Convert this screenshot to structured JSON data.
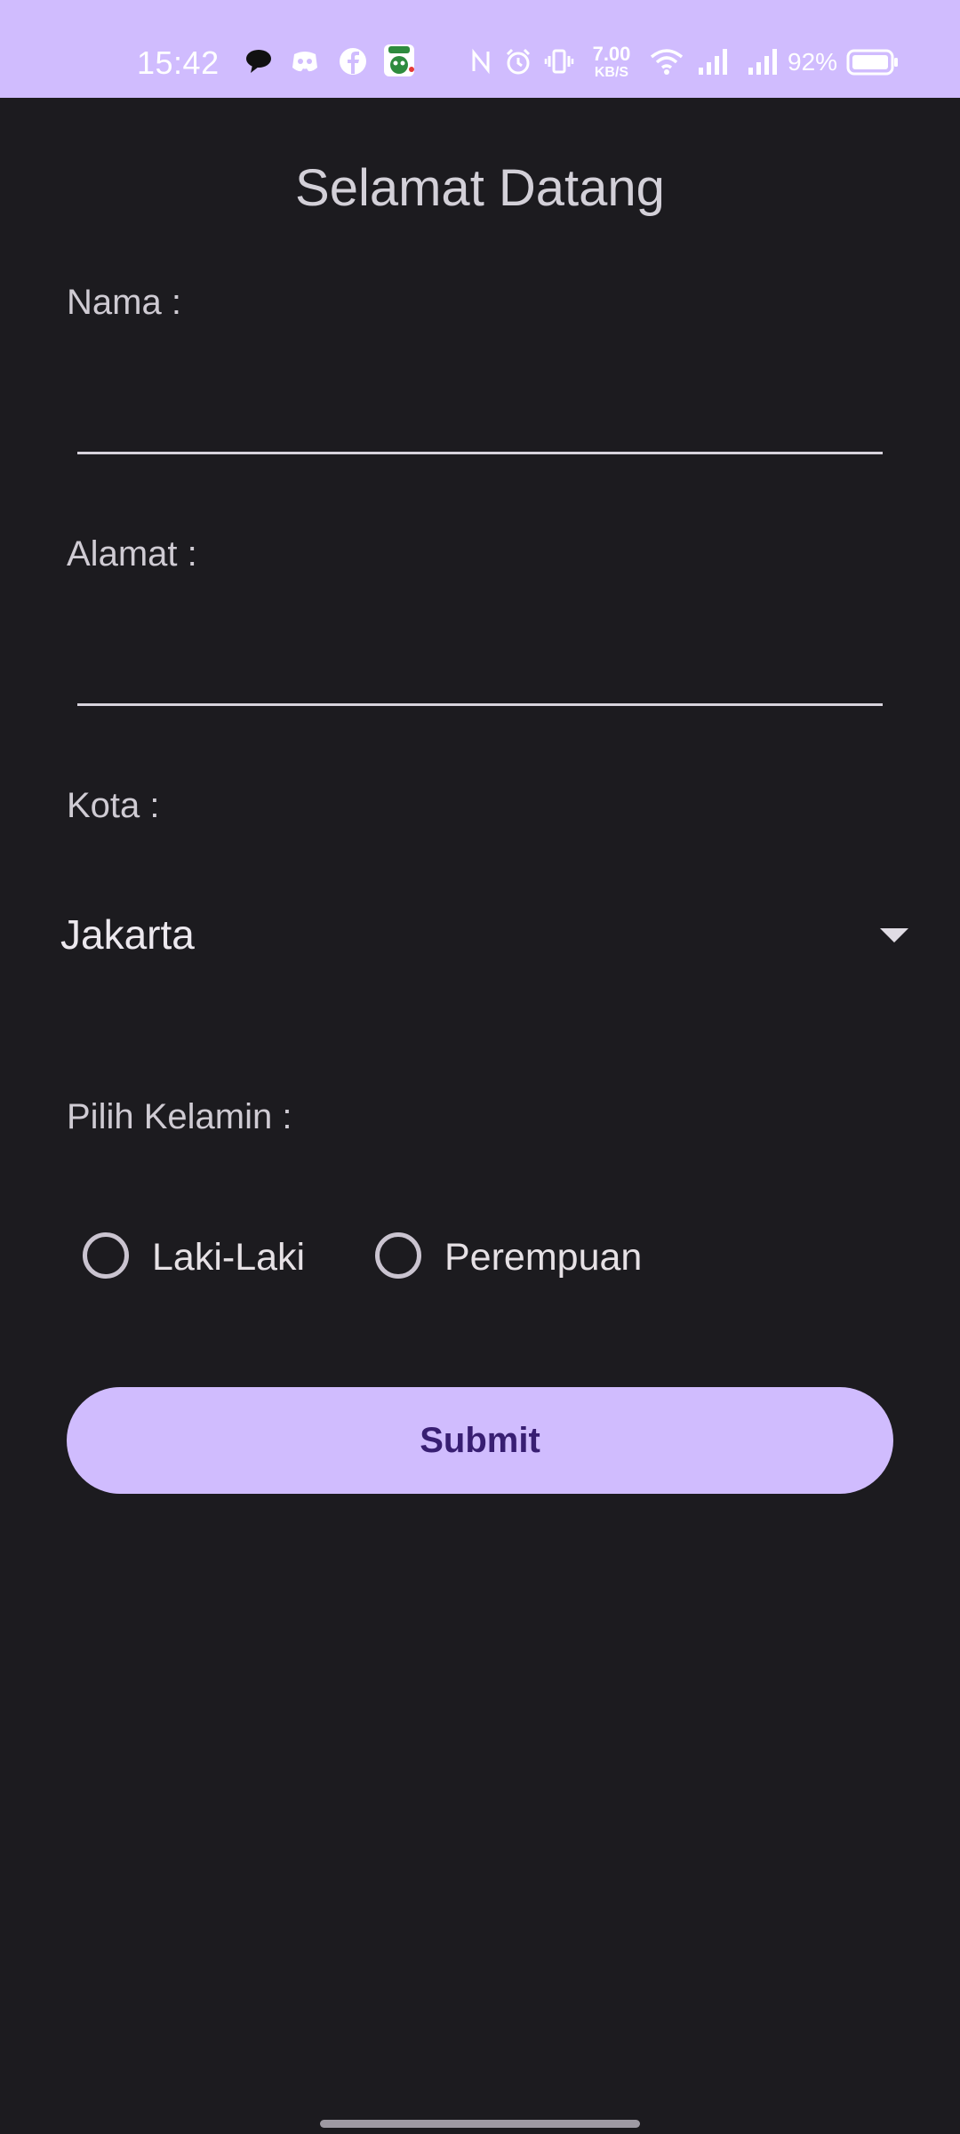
{
  "status_bar": {
    "time": "15:42",
    "network_speed_value": "7.00",
    "network_speed_unit": "KB/S",
    "battery_percent": "92%",
    "background_color": "#d0bcfe",
    "icons": [
      "chat-bubble-icon",
      "discord-icon",
      "facebook-icon",
      "sticker-app-icon",
      "nfc-icon",
      "alarm-icon",
      "vibrate-icon",
      "wifi-icon",
      "signal-icon",
      "signal-icon",
      "battery-icon"
    ]
  },
  "page": {
    "title": "Selamat Datang",
    "background_color": "#1c1b1f"
  },
  "form": {
    "name_label": "Nama :",
    "name_value": "",
    "address_label": "Alamat :",
    "address_value": "",
    "city_label": "Kota :",
    "city_selected": "Jakarta",
    "gender_label": "Pilih Kelamin :",
    "gender_options": [
      "Laki-Laki",
      "Perempuan"
    ],
    "gender_selected": null,
    "submit_label": "Submit",
    "accent_color": "#d0bcfe",
    "submit_text_color": "#381e72"
  }
}
